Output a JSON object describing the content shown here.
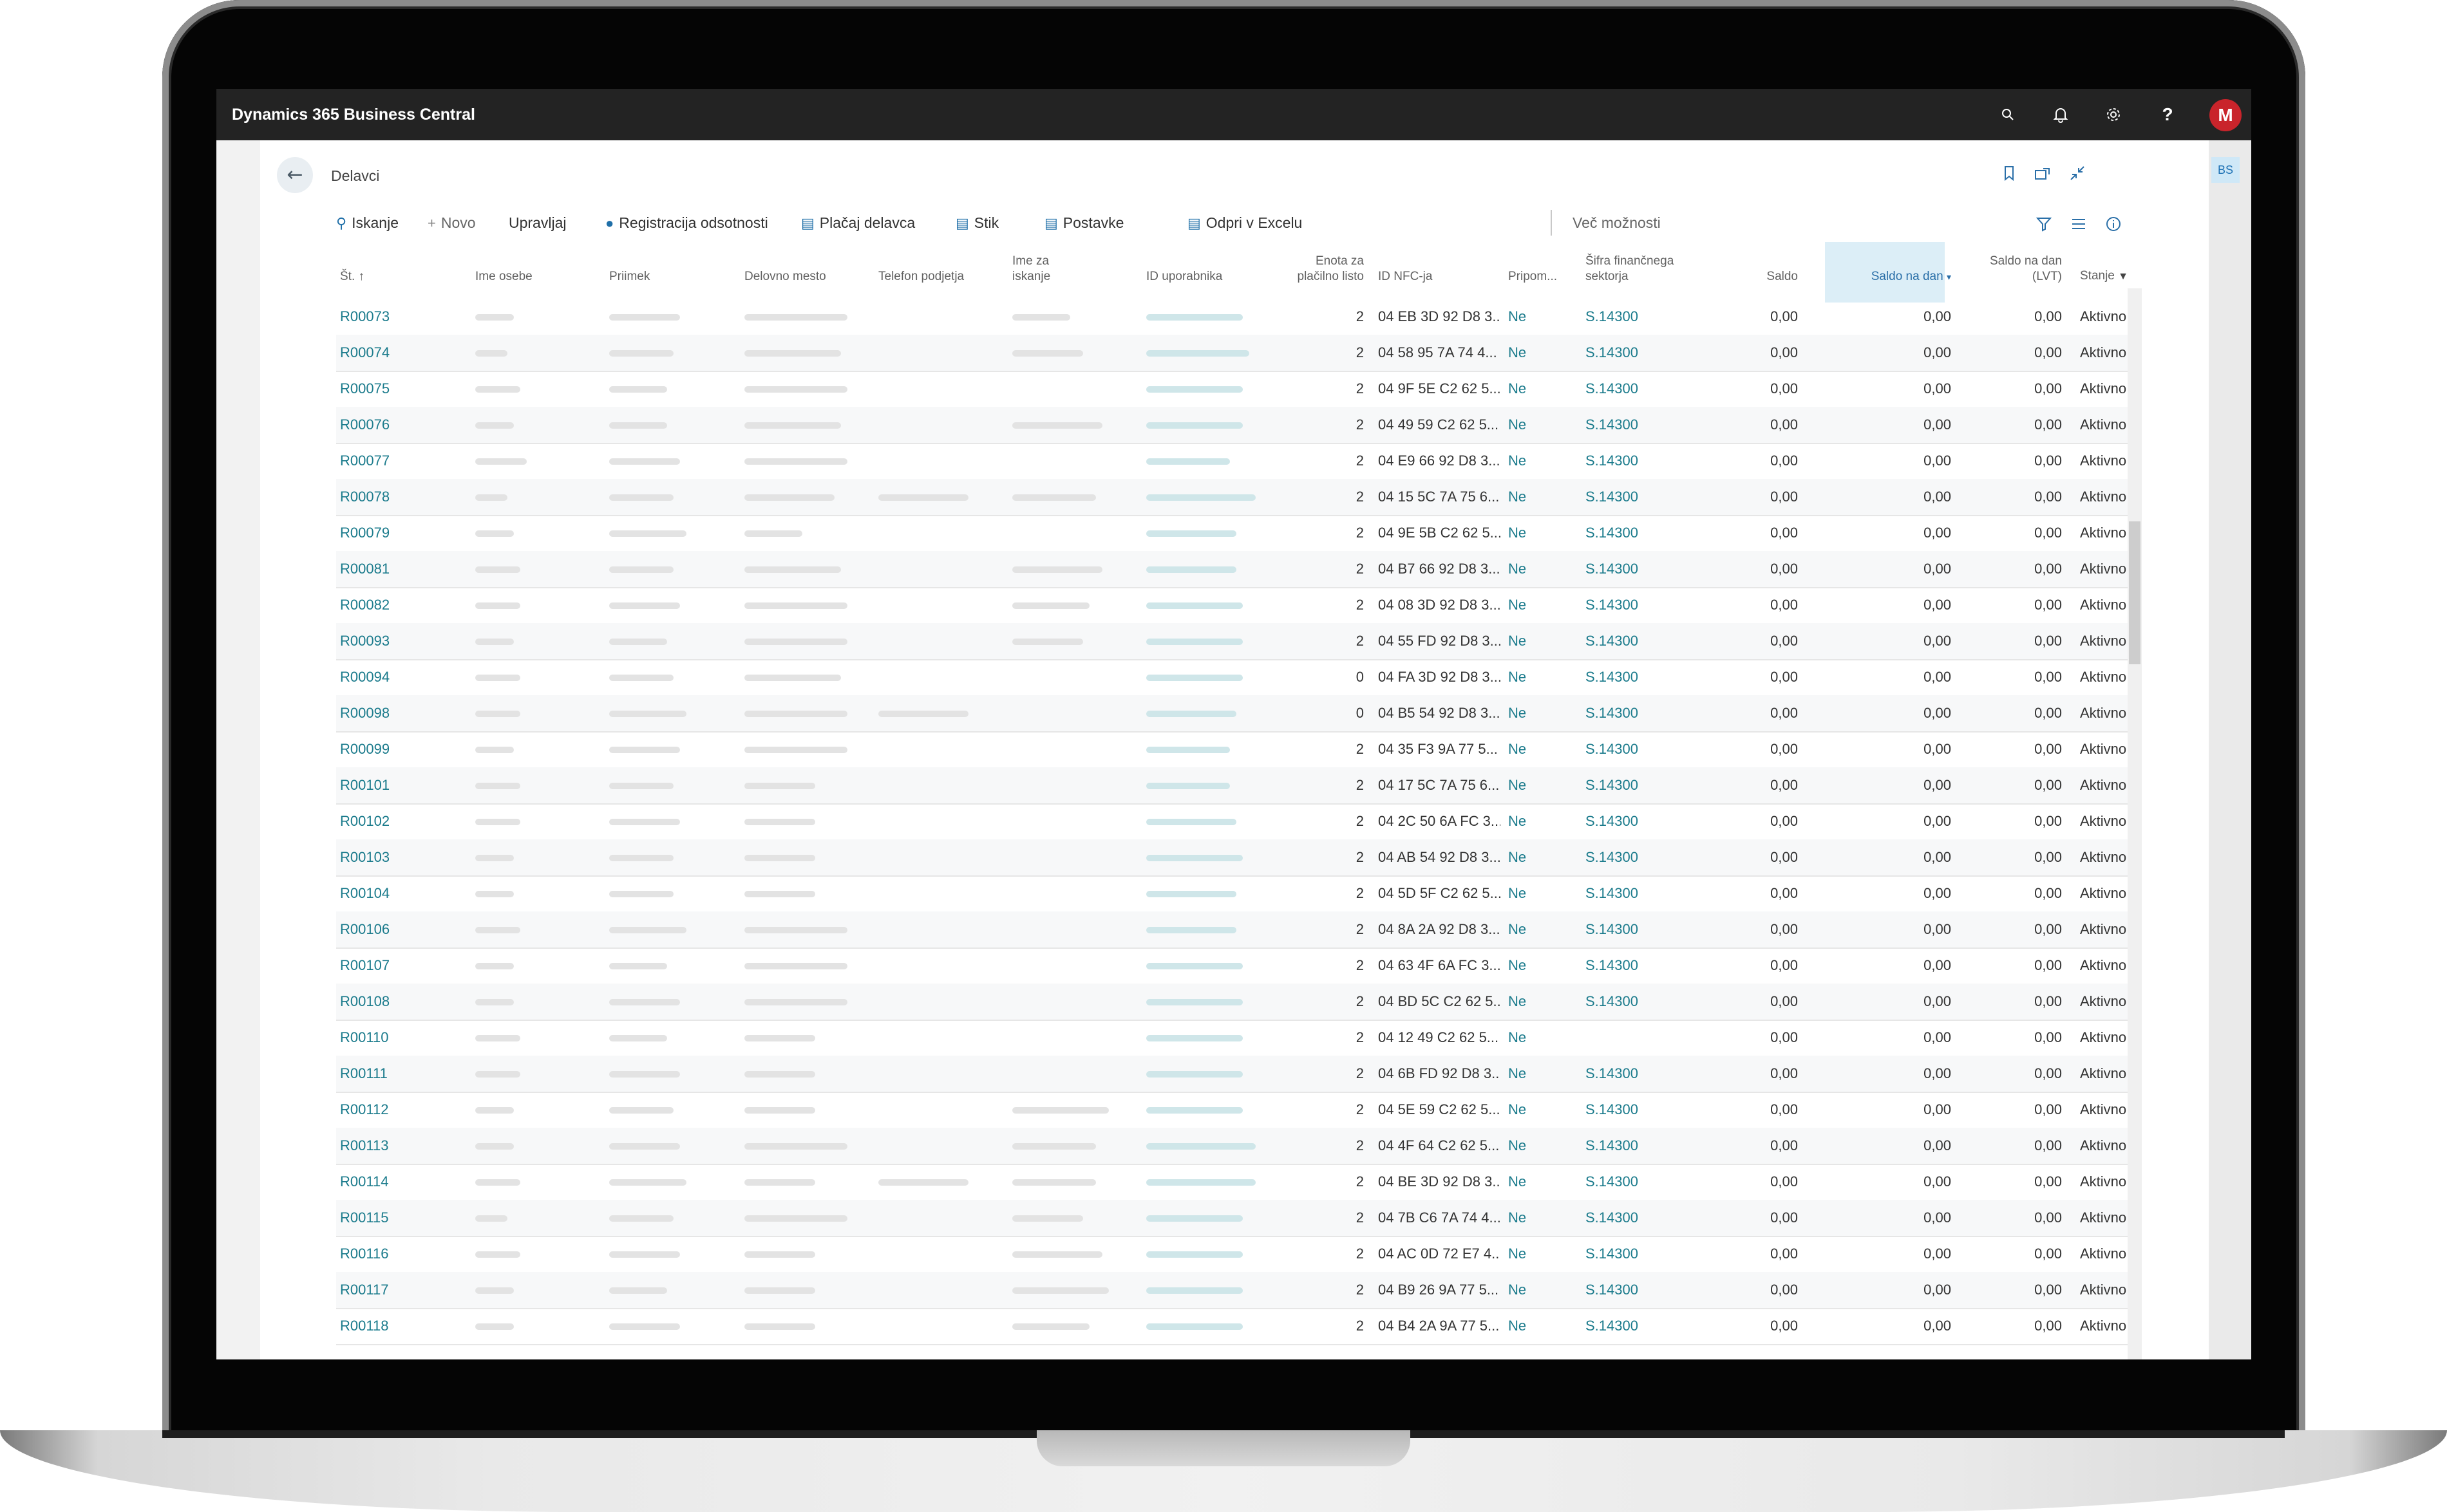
{
  "app": {
    "brand": "Dynamics 365 Business Central",
    "avatar_initial": "M",
    "side_badge": "BS"
  },
  "icons": {
    "search": "search-icon",
    "bell": "bell-icon",
    "gear": "gear-icon",
    "help": "help-icon",
    "back": "back-arrow-icon",
    "bookmark": "bookmark-icon",
    "share": "share-icon",
    "collapse": "collapse-icon",
    "filter": "filter-icon",
    "list": "list-view-icon",
    "info": "info-icon"
  },
  "page": {
    "title": "Delavci"
  },
  "actions": {
    "search": "Iskanje",
    "new": "Novo",
    "manage": "Upravljaj",
    "absence": "Registracija odsotnosti",
    "pay": "Plačaj delavca",
    "contact": "Stik",
    "settings": "Postavke",
    "excel": "Odpri v Excelu",
    "more": "Več možnosti"
  },
  "columns": {
    "no": "Št. ↑",
    "person": "Ime osebe",
    "surname": "Priimek",
    "job": "Delovno mesto",
    "phone": "Telefon podjetja",
    "search_name_1": "Ime za",
    "search_name_2": "iskanje",
    "user_id": "ID uporabnika",
    "payroll_1": "Enota za",
    "payroll_2": "plačilno listo",
    "nfc": "ID NFC-ja",
    "attach": "Pripom...",
    "sector_1": "Šifra finančnega",
    "sector_2": "sektorja",
    "balance": "Saldo",
    "balance_date": "Saldo na dan",
    "balance_lvt_1": "Saldo na dan",
    "balance_lvt_2": "(LVT)",
    "status": "Stanje"
  },
  "rows": [
    {
      "no": "R00073",
      "unit": "2",
      "nfc": "04 EB 3D 92 D8 3...",
      "att": "Ne",
      "sector": "S.14300",
      "b1": "0,00",
      "b2": "0,00",
      "b3": "0,00",
      "status": "Aktivno"
    },
    {
      "no": "R00074",
      "unit": "2",
      "nfc": "04 58 95 7A 74 4...",
      "att": "Ne",
      "sector": "S.14300",
      "b1": "0,00",
      "b2": "0,00",
      "b3": "0,00",
      "status": "Aktivno"
    },
    {
      "no": "R00075",
      "unit": "2",
      "nfc": "04 9F 5E C2 62 5...",
      "att": "Ne",
      "sector": "S.14300",
      "b1": "0,00",
      "b2": "0,00",
      "b3": "0,00",
      "status": "Aktivno"
    },
    {
      "no": "R00076",
      "unit": "2",
      "nfc": "04 49 59 C2 62 5...",
      "att": "Ne",
      "sector": "S.14300",
      "b1": "0,00",
      "b2": "0,00",
      "b3": "0,00",
      "status": "Aktivno"
    },
    {
      "no": "R00077",
      "unit": "2",
      "nfc": "04 E9 66 92 D8 3...",
      "att": "Ne",
      "sector": "S.14300",
      "b1": "0,00",
      "b2": "0,00",
      "b3": "0,00",
      "status": "Aktivno"
    },
    {
      "no": "R00078",
      "unit": "2",
      "nfc": "04 15 5C 7A 75 6...",
      "att": "Ne",
      "sector": "S.14300",
      "b1": "0,00",
      "b2": "0,00",
      "b3": "0,00",
      "status": "Aktivno"
    },
    {
      "no": "R00079",
      "unit": "2",
      "nfc": "04 9E 5B C2 62 5...",
      "att": "Ne",
      "sector": "S.14300",
      "b1": "0,00",
      "b2": "0,00",
      "b3": "0,00",
      "status": "Aktivno"
    },
    {
      "no": "R00081",
      "unit": "2",
      "nfc": "04 B7 66 92 D8 3...",
      "att": "Ne",
      "sector": "S.14300",
      "b1": "0,00",
      "b2": "0,00",
      "b3": "0,00",
      "status": "Aktivno"
    },
    {
      "no": "R00082",
      "unit": "2",
      "nfc": "04 08 3D 92 D8 3...",
      "att": "Ne",
      "sector": "S.14300",
      "b1": "0,00",
      "b2": "0,00",
      "b3": "0,00",
      "status": "Aktivno"
    },
    {
      "no": "R00093",
      "unit": "2",
      "nfc": "04 55 FD 92 D8 3...",
      "att": "Ne",
      "sector": "S.14300",
      "b1": "0,00",
      "b2": "0,00",
      "b3": "0,00",
      "status": "Aktivno"
    },
    {
      "no": "R00094",
      "unit": "0",
      "nfc": "04 FA 3D 92 D8 3...",
      "att": "Ne",
      "sector": "S.14300",
      "b1": "0,00",
      "b2": "0,00",
      "b3": "0,00",
      "status": "Aktivno"
    },
    {
      "no": "R00098",
      "unit": "0",
      "nfc": "04 B5 54 92 D8 3...",
      "att": "Ne",
      "sector": "S.14300",
      "b1": "0,00",
      "b2": "0,00",
      "b3": "0,00",
      "status": "Aktivno"
    },
    {
      "no": "R00099",
      "unit": "2",
      "nfc": "04 35 F3 9A 77 5...",
      "att": "Ne",
      "sector": "S.14300",
      "b1": "0,00",
      "b2": "0,00",
      "b3": "0,00",
      "status": "Aktivno"
    },
    {
      "no": "R00101",
      "unit": "2",
      "nfc": "04 17 5C 7A 75 6...",
      "att": "Ne",
      "sector": "S.14300",
      "b1": "0,00",
      "b2": "0,00",
      "b3": "0,00",
      "status": "Aktivno"
    },
    {
      "no": "R00102",
      "unit": "2",
      "nfc": "04 2C 50 6A FC 3...",
      "att": "Ne",
      "sector": "S.14300",
      "b1": "0,00",
      "b2": "0,00",
      "b3": "0,00",
      "status": "Aktivno"
    },
    {
      "no": "R00103",
      "unit": "2",
      "nfc": "04 AB 54 92 D8 3...",
      "att": "Ne",
      "sector": "S.14300",
      "b1": "0,00",
      "b2": "0,00",
      "b3": "0,00",
      "status": "Aktivno"
    },
    {
      "no": "R00104",
      "unit": "2",
      "nfc": "04 5D 5F C2 62 5...",
      "att": "Ne",
      "sector": "S.14300",
      "b1": "0,00",
      "b2": "0,00",
      "b3": "0,00",
      "status": "Aktivno"
    },
    {
      "no": "R00106",
      "unit": "2",
      "nfc": "04 8A 2A 92 D8 3...",
      "att": "Ne",
      "sector": "S.14300",
      "b1": "0,00",
      "b2": "0,00",
      "b3": "0,00",
      "status": "Aktivno"
    },
    {
      "no": "R00107",
      "unit": "2",
      "nfc": "04 63 4F 6A FC 3...",
      "att": "Ne",
      "sector": "S.14300",
      "b1": "0,00",
      "b2": "0,00",
      "b3": "0,00",
      "status": "Aktivno"
    },
    {
      "no": "R00108",
      "unit": "2",
      "nfc": "04 BD 5C C2 62 5...",
      "att": "Ne",
      "sector": "S.14300",
      "b1": "0,00",
      "b2": "0,00",
      "b3": "0,00",
      "status": "Aktivno"
    },
    {
      "no": "R00110",
      "unit": "2",
      "nfc": "04 12 49 C2 62 5...",
      "att": "Ne",
      "sector": "",
      "b1": "0,00",
      "b2": "0,00",
      "b3": "0,00",
      "status": "Aktivno"
    },
    {
      "no": "R00111",
      "unit": "2",
      "nfc": "04 6B FD 92 D8 3...",
      "att": "Ne",
      "sector": "S.14300",
      "b1": "0,00",
      "b2": "0,00",
      "b3": "0,00",
      "status": "Aktivno"
    },
    {
      "no": "R00112",
      "unit": "2",
      "nfc": "04 5E 59 C2 62 5...",
      "att": "Ne",
      "sector": "S.14300",
      "b1": "0,00",
      "b2": "0,00",
      "b3": "0,00",
      "status": "Aktivno"
    },
    {
      "no": "R00113",
      "unit": "2",
      "nfc": "04 4F 64 C2 62 5...",
      "att": "Ne",
      "sector": "S.14300",
      "b1": "0,00",
      "b2": "0,00",
      "b3": "0,00",
      "status": "Aktivno"
    },
    {
      "no": "R00114",
      "unit": "2",
      "nfc": "04 BE 3D 92 D8 3...",
      "att": "Ne",
      "sector": "S.14300",
      "b1": "0,00",
      "b2": "0,00",
      "b3": "0,00",
      "status": "Aktivno"
    },
    {
      "no": "R00115",
      "unit": "2",
      "nfc": "04 7B C6 7A 74 4...",
      "att": "Ne",
      "sector": "S.14300",
      "b1": "0,00",
      "b2": "0,00",
      "b3": "0,00",
      "status": "Aktivno"
    },
    {
      "no": "R00116",
      "unit": "2",
      "nfc": "04 AC 0D 72 E7 4...",
      "att": "Ne",
      "sector": "S.14300",
      "b1": "0,00",
      "b2": "0,00",
      "b3": "0,00",
      "status": "Aktivno"
    },
    {
      "no": "R00117",
      "unit": "2",
      "nfc": "04 B9 26 9A 77 5...",
      "att": "Ne",
      "sector": "S.14300",
      "b1": "0,00",
      "b2": "0,00",
      "b3": "0,00",
      "status": "Aktivno"
    },
    {
      "no": "R00118",
      "unit": "2",
      "nfc": "04 B4 2A 9A 77 5...",
      "att": "Ne",
      "sector": "S.14300",
      "b1": "0,00",
      "b2": "0,00",
      "b3": "0,00",
      "status": "Aktivno"
    }
  ]
}
